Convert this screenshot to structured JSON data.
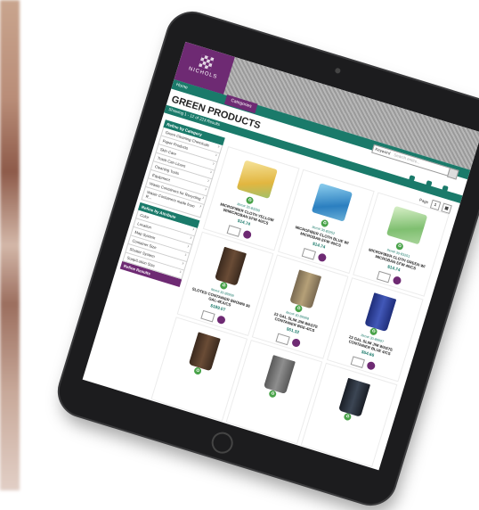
{
  "header": {
    "logo_text": "NICHOLS",
    "home_label": "Home",
    "categories_label": "Categories",
    "search_keyword": "Keyword",
    "search_placeholder": "Search entire..."
  },
  "page_title": "GREEN PRODUCTS",
  "results_text": "Showing 1 - 12 of 223 Results",
  "toolbar": {
    "page_label": "Page",
    "page_num": "1"
  },
  "sidebar": {
    "category_header": "Refine by Category",
    "categories": [
      "Green Cleaning Chemicals",
      "Paper Products",
      "Skin Care",
      "Trash Can Liners",
      "Cleaning Tools",
      "Equipment",
      "Waste Containers for Recycling",
      "Waste Containers made from R..."
    ],
    "attribute_header": "Refine by Attribute",
    "attributes": [
      "Color",
      "Location",
      "Map System",
      "Container Size",
      "Shutter System",
      "Soap/Lotion Size"
    ],
    "footer": "Refine Results"
  },
  "products": [
    {
      "item": "Item# 30-83250",
      "name": "MICROFIBER CLOTH YELLOW W/MICROBAN EFW 40/CS",
      "price": "$14.74",
      "pic": "cloth-y"
    },
    {
      "item": "Item# 30-83252",
      "name": "MICROFIBER CLOTH BLUE W/ MICROBAN EFW 40/CS",
      "price": "$14.74",
      "pic": "cloth-b"
    },
    {
      "item": "Item# 30-83251",
      "name": "MICROFIBER CLOTH GREEN W/ MICROBAN EFW 40/CS",
      "price": "$14.74",
      "pic": "cloth-g"
    },
    {
      "item": "Item# 30-89999",
      "name": "SLOTED CONTAINER BROWN 36 GAL-4EA/CS",
      "price": "$189.07",
      "pic": "can-br"
    },
    {
      "item": "Item# 30-89998",
      "name": "23 GAL SLIM JIM WASTE CONTAINER BGE-4/CS",
      "price": "$51.32",
      "pic": "can-bg"
    },
    {
      "item": "Item# 30-89997",
      "name": "23 GAL SLIM JIM WASTE CONTAINER BLUE 4/CS",
      "price": "$54.66",
      "pic": "can-bl"
    },
    {
      "item": "",
      "name": "",
      "price": "",
      "pic": "can-br"
    },
    {
      "item": "",
      "name": "",
      "price": "",
      "pic": "can-gy"
    },
    {
      "item": "",
      "name": "",
      "price": "",
      "pic": "can-dk"
    }
  ]
}
